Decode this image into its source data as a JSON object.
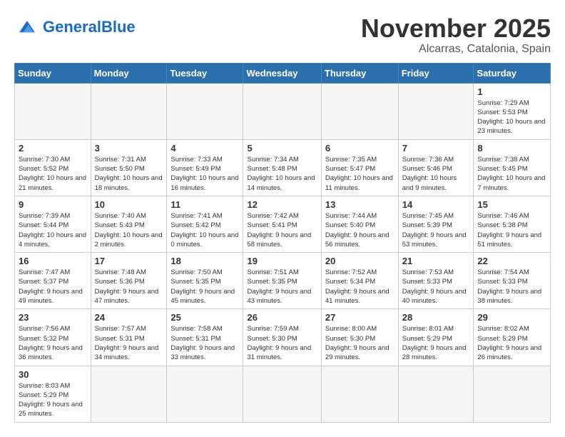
{
  "logo": {
    "text_general": "General",
    "text_blue": "Blue"
  },
  "header": {
    "month": "November 2025",
    "location": "Alcarras, Catalonia, Spain"
  },
  "weekdays": [
    "Sunday",
    "Monday",
    "Tuesday",
    "Wednesday",
    "Thursday",
    "Friday",
    "Saturday"
  ],
  "weeks": [
    [
      {
        "day": "",
        "info": ""
      },
      {
        "day": "",
        "info": ""
      },
      {
        "day": "",
        "info": ""
      },
      {
        "day": "",
        "info": ""
      },
      {
        "day": "",
        "info": ""
      },
      {
        "day": "",
        "info": ""
      },
      {
        "day": "1",
        "info": "Sunrise: 7:29 AM\nSunset: 5:53 PM\nDaylight: 10 hours and 23 minutes."
      }
    ],
    [
      {
        "day": "2",
        "info": "Sunrise: 7:30 AM\nSunset: 5:52 PM\nDaylight: 10 hours and 21 minutes."
      },
      {
        "day": "3",
        "info": "Sunrise: 7:31 AM\nSunset: 5:50 PM\nDaylight: 10 hours and 18 minutes."
      },
      {
        "day": "4",
        "info": "Sunrise: 7:33 AM\nSunset: 5:49 PM\nDaylight: 10 hours and 16 minutes."
      },
      {
        "day": "5",
        "info": "Sunrise: 7:34 AM\nSunset: 5:48 PM\nDaylight: 10 hours and 14 minutes."
      },
      {
        "day": "6",
        "info": "Sunrise: 7:35 AM\nSunset: 5:47 PM\nDaylight: 10 hours and 11 minutes."
      },
      {
        "day": "7",
        "info": "Sunrise: 7:36 AM\nSunset: 5:46 PM\nDaylight: 10 hours and 9 minutes."
      },
      {
        "day": "8",
        "info": "Sunrise: 7:38 AM\nSunset: 5:45 PM\nDaylight: 10 hours and 7 minutes."
      }
    ],
    [
      {
        "day": "9",
        "info": "Sunrise: 7:39 AM\nSunset: 5:44 PM\nDaylight: 10 hours and 4 minutes."
      },
      {
        "day": "10",
        "info": "Sunrise: 7:40 AM\nSunset: 5:43 PM\nDaylight: 10 hours and 2 minutes."
      },
      {
        "day": "11",
        "info": "Sunrise: 7:41 AM\nSunset: 5:42 PM\nDaylight: 10 hours and 0 minutes."
      },
      {
        "day": "12",
        "info": "Sunrise: 7:42 AM\nSunset: 5:41 PM\nDaylight: 9 hours and 58 minutes."
      },
      {
        "day": "13",
        "info": "Sunrise: 7:44 AM\nSunset: 5:40 PM\nDaylight: 9 hours and 56 minutes."
      },
      {
        "day": "14",
        "info": "Sunrise: 7:45 AM\nSunset: 5:39 PM\nDaylight: 9 hours and 53 minutes."
      },
      {
        "day": "15",
        "info": "Sunrise: 7:46 AM\nSunset: 5:38 PM\nDaylight: 9 hours and 51 minutes."
      }
    ],
    [
      {
        "day": "16",
        "info": "Sunrise: 7:47 AM\nSunset: 5:37 PM\nDaylight: 9 hours and 49 minutes."
      },
      {
        "day": "17",
        "info": "Sunrise: 7:48 AM\nSunset: 5:36 PM\nDaylight: 9 hours and 47 minutes."
      },
      {
        "day": "18",
        "info": "Sunrise: 7:50 AM\nSunset: 5:35 PM\nDaylight: 9 hours and 45 minutes."
      },
      {
        "day": "19",
        "info": "Sunrise: 7:51 AM\nSunset: 5:35 PM\nDaylight: 9 hours and 43 minutes."
      },
      {
        "day": "20",
        "info": "Sunrise: 7:52 AM\nSunset: 5:34 PM\nDaylight: 9 hours and 41 minutes."
      },
      {
        "day": "21",
        "info": "Sunrise: 7:53 AM\nSunset: 5:33 PM\nDaylight: 9 hours and 40 minutes."
      },
      {
        "day": "22",
        "info": "Sunrise: 7:54 AM\nSunset: 5:33 PM\nDaylight: 9 hours and 38 minutes."
      }
    ],
    [
      {
        "day": "23",
        "info": "Sunrise: 7:56 AM\nSunset: 5:32 PM\nDaylight: 9 hours and 36 minutes."
      },
      {
        "day": "24",
        "info": "Sunrise: 7:57 AM\nSunset: 5:31 PM\nDaylight: 9 hours and 34 minutes."
      },
      {
        "day": "25",
        "info": "Sunrise: 7:58 AM\nSunset: 5:31 PM\nDaylight: 9 hours and 33 minutes."
      },
      {
        "day": "26",
        "info": "Sunrise: 7:59 AM\nSunset: 5:30 PM\nDaylight: 9 hours and 31 minutes."
      },
      {
        "day": "27",
        "info": "Sunrise: 8:00 AM\nSunset: 5:30 PM\nDaylight: 9 hours and 29 minutes."
      },
      {
        "day": "28",
        "info": "Sunrise: 8:01 AM\nSunset: 5:29 PM\nDaylight: 9 hours and 28 minutes."
      },
      {
        "day": "29",
        "info": "Sunrise: 8:02 AM\nSunset: 5:29 PM\nDaylight: 9 hours and 26 minutes."
      }
    ],
    [
      {
        "day": "30",
        "info": "Sunrise: 8:03 AM\nSunset: 5:29 PM\nDaylight: 9 hours and 25 minutes."
      },
      {
        "day": "",
        "info": ""
      },
      {
        "day": "",
        "info": ""
      },
      {
        "day": "",
        "info": ""
      },
      {
        "day": "",
        "info": ""
      },
      {
        "day": "",
        "info": ""
      },
      {
        "day": "",
        "info": ""
      }
    ]
  ]
}
